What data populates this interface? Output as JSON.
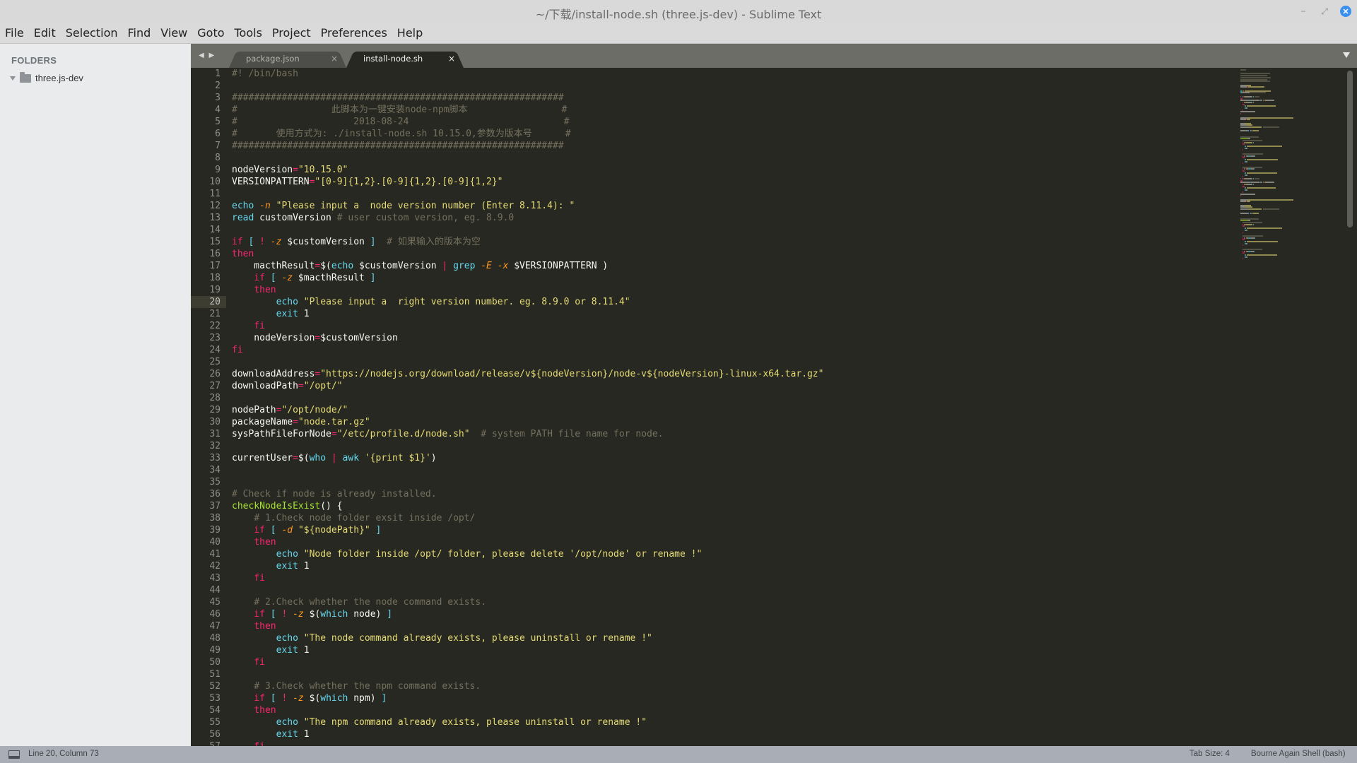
{
  "window": {
    "title": "~/下载/install-node.sh (three.js-dev) - Sublime Text",
    "controls": {
      "minimize": "−",
      "maximize": "⤢",
      "close": "✕"
    }
  },
  "menu": [
    "File",
    "Edit",
    "Selection",
    "Find",
    "View",
    "Goto",
    "Tools",
    "Project",
    "Preferences",
    "Help"
  ],
  "sidebar": {
    "title": "FOLDERS",
    "folders": [
      {
        "name": "three.js-dev",
        "expanded": true
      }
    ]
  },
  "tabs": {
    "nav_arrows": "◀ ▶",
    "items": [
      {
        "label": "package.json",
        "active": false,
        "close": "×"
      },
      {
        "label": "install-node.sh",
        "active": true,
        "close": "×"
      }
    ]
  },
  "editor": {
    "active_line": 20,
    "first_line": 1,
    "lines": [
      [
        [
          "t-cmt",
          "#! /bin/bash"
        ]
      ],
      [],
      [
        [
          "t-hdr",
          "############################################################"
        ]
      ],
      [
        [
          "t-hdr",
          "#                 此脚本为一键安装node-npm脚本                 #"
        ]
      ],
      [
        [
          "t-hdr",
          "#                     2018-08-24                            #"
        ]
      ],
      [
        [
          "t-hdr",
          "#       使用方式为: ./install-node.sh 10.15.0,参数为版本号      #"
        ]
      ],
      [
        [
          "t-hdr",
          "############################################################"
        ]
      ],
      [],
      [
        [
          "t-plain",
          "nodeVersion"
        ],
        [
          "t-op",
          "="
        ],
        [
          "t-str",
          "\"10.15.0\""
        ]
      ],
      [
        [
          "t-plain",
          "VERSIONPATTERN"
        ],
        [
          "t-op",
          "="
        ],
        [
          "t-str",
          "\"[0-9]{1,2}.[0-9]{1,2}.[0-9]{1,2}\""
        ]
      ],
      [],
      [
        [
          "t-fn",
          "echo"
        ],
        [
          "t-plain",
          " "
        ],
        [
          "t-flag",
          "-n"
        ],
        [
          "t-plain",
          " "
        ],
        [
          "t-str",
          "\"Please input a  node version number (Enter 8.11.4): \""
        ]
      ],
      [
        [
          "t-fn",
          "read"
        ],
        [
          "t-plain",
          " customVersion "
        ],
        [
          "t-cmt",
          "# user custom version, eg. 8.9.0"
        ]
      ],
      [],
      [
        [
          "t-kw",
          "if"
        ],
        [
          "t-plain",
          " "
        ],
        [
          "t-br",
          "["
        ],
        [
          "t-plain",
          " "
        ],
        [
          "t-kw",
          "!"
        ],
        [
          "t-plain",
          " "
        ],
        [
          "t-flag",
          "-z"
        ],
        [
          "t-plain",
          " $customVersion "
        ],
        [
          "t-br",
          "]"
        ],
        [
          "t-plain",
          "  "
        ],
        [
          "t-cmt",
          "# 如果输入的版本为空"
        ]
      ],
      [
        [
          "t-kw",
          "then"
        ]
      ],
      [
        [
          "t-plain",
          "    macthResult"
        ],
        [
          "t-op",
          "="
        ],
        [
          "t-plain",
          "$("
        ],
        [
          "t-fn",
          "echo"
        ],
        [
          "t-plain",
          " $customVersion "
        ],
        [
          "t-op",
          "|"
        ],
        [
          "t-plain",
          " "
        ],
        [
          "t-fn",
          "grep"
        ],
        [
          "t-plain",
          " "
        ],
        [
          "t-flag",
          "-E"
        ],
        [
          "t-plain",
          " "
        ],
        [
          "t-flag",
          "-x"
        ],
        [
          "t-plain",
          " $VERSIONPATTERN )"
        ]
      ],
      [
        [
          "t-plain",
          "    "
        ],
        [
          "t-kw",
          "if"
        ],
        [
          "t-plain",
          " "
        ],
        [
          "t-br",
          "["
        ],
        [
          "t-plain",
          " "
        ],
        [
          "t-flag",
          "-z"
        ],
        [
          "t-plain",
          " $macthResult "
        ],
        [
          "t-br",
          "]"
        ]
      ],
      [
        [
          "t-plain",
          "    "
        ],
        [
          "t-kw",
          "then"
        ]
      ],
      [
        [
          "t-plain",
          "        "
        ],
        [
          "t-fn",
          "echo"
        ],
        [
          "t-plain",
          " "
        ],
        [
          "t-str",
          "\"Please input a  right version number. eg. 8.9.0 or 8.11.4\""
        ]
      ],
      [
        [
          "t-plain",
          "        "
        ],
        [
          "t-fn",
          "exit"
        ],
        [
          "t-plain",
          " 1"
        ]
      ],
      [
        [
          "t-plain",
          "    "
        ],
        [
          "t-kw",
          "fi"
        ]
      ],
      [
        [
          "t-plain",
          "    nodeVersion"
        ],
        [
          "t-op",
          "="
        ],
        [
          "t-plain",
          "$customVersion"
        ]
      ],
      [
        [
          "t-kw",
          "fi"
        ]
      ],
      [],
      [
        [
          "t-plain",
          "downloadAddress"
        ],
        [
          "t-op",
          "="
        ],
        [
          "t-str",
          "\"https://nodejs.org/download/release/v${nodeVersion}/node-v${nodeVersion}-linux-x64.tar.gz\""
        ]
      ],
      [
        [
          "t-plain",
          "downloadPath"
        ],
        [
          "t-op",
          "="
        ],
        [
          "t-str",
          "\"/opt/\""
        ]
      ],
      [],
      [
        [
          "t-plain",
          "nodePath"
        ],
        [
          "t-op",
          "="
        ],
        [
          "t-str",
          "\"/opt/node/\""
        ]
      ],
      [
        [
          "t-plain",
          "packageName"
        ],
        [
          "t-op",
          "="
        ],
        [
          "t-str",
          "\"node.tar.gz\""
        ]
      ],
      [
        [
          "t-plain",
          "sysPathFileForNode"
        ],
        [
          "t-op",
          "="
        ],
        [
          "t-str",
          "\"/etc/profile.d/node.sh\""
        ],
        [
          "t-plain",
          "  "
        ],
        [
          "t-cmt",
          "# system PATH file name for node."
        ]
      ],
      [],
      [
        [
          "t-plain",
          "currentUser"
        ],
        [
          "t-op",
          "="
        ],
        [
          "t-plain",
          "$("
        ],
        [
          "t-fn",
          "who"
        ],
        [
          "t-plain",
          " "
        ],
        [
          "t-op",
          "|"
        ],
        [
          "t-plain",
          " "
        ],
        [
          "t-fn",
          "awk"
        ],
        [
          "t-plain",
          " "
        ],
        [
          "t-str",
          "'{print $1}'"
        ],
        [
          "t-plain",
          ")"
        ]
      ],
      [],
      [],
      [
        [
          "t-cmt",
          "# Check if node is already installed."
        ]
      ],
      [
        [
          "t-def",
          "checkNodeIsExist"
        ],
        [
          "t-plain",
          "() {"
        ]
      ],
      [
        [
          "t-plain",
          "    "
        ],
        [
          "t-cmt",
          "# 1.Check node folder exsit inside /opt/"
        ]
      ],
      [
        [
          "t-plain",
          "    "
        ],
        [
          "t-kw",
          "if"
        ],
        [
          "t-plain",
          " "
        ],
        [
          "t-br",
          "["
        ],
        [
          "t-plain",
          " "
        ],
        [
          "t-flag",
          "-d"
        ],
        [
          "t-plain",
          " "
        ],
        [
          "t-str",
          "\"${nodePath}\""
        ],
        [
          "t-plain",
          " "
        ],
        [
          "t-br",
          "]"
        ]
      ],
      [
        [
          "t-plain",
          "    "
        ],
        [
          "t-kw",
          "then"
        ]
      ],
      [
        [
          "t-plain",
          "        "
        ],
        [
          "t-fn",
          "echo"
        ],
        [
          "t-plain",
          " "
        ],
        [
          "t-str",
          "\"Node folder inside /opt/ folder, please delete '/opt/node' or rename !\""
        ]
      ],
      [
        [
          "t-plain",
          "        "
        ],
        [
          "t-fn",
          "exit"
        ],
        [
          "t-plain",
          " 1"
        ]
      ],
      [
        [
          "t-plain",
          "    "
        ],
        [
          "t-kw",
          "fi"
        ]
      ],
      [],
      [
        [
          "t-plain",
          "    "
        ],
        [
          "t-cmt",
          "# 2.Check whether the node command exists."
        ]
      ],
      [
        [
          "t-plain",
          "    "
        ],
        [
          "t-kw",
          "if"
        ],
        [
          "t-plain",
          " "
        ],
        [
          "t-br",
          "["
        ],
        [
          "t-plain",
          " "
        ],
        [
          "t-kw",
          "!"
        ],
        [
          "t-plain",
          " "
        ],
        [
          "t-flag",
          "-z"
        ],
        [
          "t-plain",
          " $("
        ],
        [
          "t-fn",
          "which"
        ],
        [
          "t-plain",
          " node) "
        ],
        [
          "t-br",
          "]"
        ]
      ],
      [
        [
          "t-plain",
          "    "
        ],
        [
          "t-kw",
          "then"
        ]
      ],
      [
        [
          "t-plain",
          "        "
        ],
        [
          "t-fn",
          "echo"
        ],
        [
          "t-plain",
          " "
        ],
        [
          "t-str",
          "\"The node command already exists, please uninstall or rename !\""
        ]
      ],
      [
        [
          "t-plain",
          "        "
        ],
        [
          "t-fn",
          "exit"
        ],
        [
          "t-plain",
          " 1"
        ]
      ],
      [
        [
          "t-plain",
          "    "
        ],
        [
          "t-kw",
          "fi"
        ]
      ],
      [],
      [
        [
          "t-plain",
          "    "
        ],
        [
          "t-cmt",
          "# 3.Check whether the npm command exists."
        ]
      ],
      [
        [
          "t-plain",
          "    "
        ],
        [
          "t-kw",
          "if"
        ],
        [
          "t-plain",
          " "
        ],
        [
          "t-br",
          "["
        ],
        [
          "t-plain",
          " "
        ],
        [
          "t-kw",
          "!"
        ],
        [
          "t-plain",
          " "
        ],
        [
          "t-flag",
          "-z"
        ],
        [
          "t-plain",
          " $("
        ],
        [
          "t-fn",
          "which"
        ],
        [
          "t-plain",
          " npm) "
        ],
        [
          "t-br",
          "]"
        ]
      ],
      [
        [
          "t-plain",
          "    "
        ],
        [
          "t-kw",
          "then"
        ]
      ],
      [
        [
          "t-plain",
          "        "
        ],
        [
          "t-fn",
          "echo"
        ],
        [
          "t-plain",
          " "
        ],
        [
          "t-str",
          "\"The npm command already exists, please uninstall or rename !\""
        ]
      ],
      [
        [
          "t-plain",
          "        "
        ],
        [
          "t-fn",
          "exit"
        ],
        [
          "t-plain",
          " 1"
        ]
      ],
      [
        [
          "t-plain",
          "    "
        ],
        [
          "t-kw",
          "fi"
        ]
      ]
    ]
  },
  "statusbar": {
    "position": "Line 20, Column 73",
    "tab_size": "Tab Size: 4",
    "syntax": "Bourne Again Shell (bash)"
  },
  "theme": {
    "editor_bg": "#272822",
    "accent_close": "#3b8ff0",
    "keyword": "#f92672",
    "string": "#e6db74",
    "function": "#66d9ef",
    "comment": "#75715e",
    "definition": "#a6e22e"
  }
}
